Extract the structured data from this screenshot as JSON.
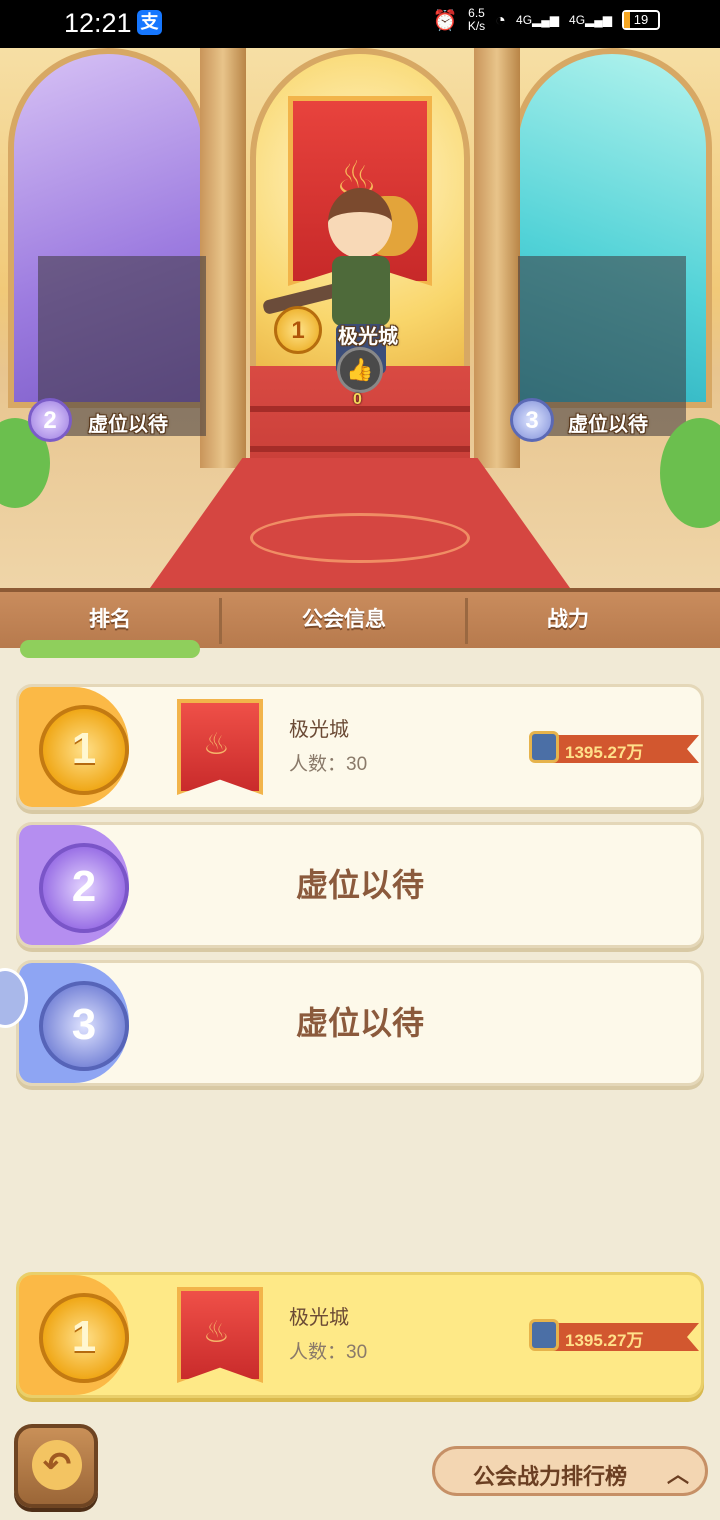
{
  "status_bar": {
    "time": "12:21",
    "alipay_glyph": "支",
    "net_speed_value": "6.5",
    "net_speed_unit": "K/s",
    "signal_1": "4G",
    "signal_2": "4G",
    "battery": "19"
  },
  "hall": {
    "first_place_name": "极光城",
    "first_place_rank": "1",
    "like_count": "0",
    "like_icon": "thumbs-up-icon",
    "second_place_label": "虚位以待",
    "second_place_rank": "2",
    "third_place_label": "虚位以待",
    "third_place_rank": "3"
  },
  "tabs": {
    "rank": "排名",
    "guild_info": "公会信息",
    "power": "战力"
  },
  "rows": [
    {
      "rank": "1",
      "name": "极光城",
      "members": "人数：30",
      "power": "1395.27万",
      "medal": "gold-medal-icon"
    },
    {
      "rank": "2",
      "placeholder": "虚位以待",
      "medal": "purple-medal-icon"
    },
    {
      "rank": "3",
      "placeholder": "虚位以待",
      "medal": "blue-medal-icon"
    }
  ],
  "my_guild": {
    "rank": "1",
    "name": "极光城",
    "members": "人数：30",
    "power": "1395.27万"
  },
  "bottom": {
    "back_icon": "back-arrow-icon",
    "leaderboard_label": "公会战力排行榜",
    "leaderboard_chevron": "︿"
  },
  "colors": {
    "gold": "#f0a818",
    "purple": "#9b72e6",
    "blue": "#7c89d9",
    "tab_bg": "#c98c5d",
    "my_row_bg": "#fee987"
  }
}
